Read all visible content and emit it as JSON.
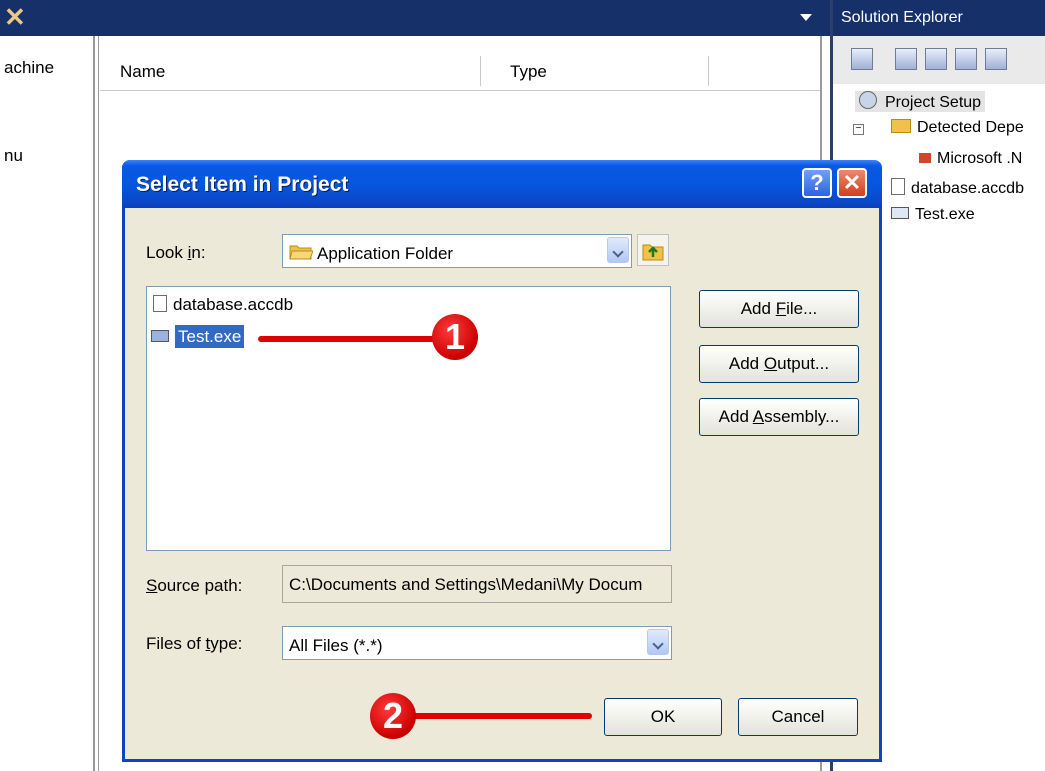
{
  "ide": {
    "left_pane": {
      "item_machine": "achine",
      "item_menu": "nu"
    },
    "list_columns": {
      "name": "Name",
      "type": "Type"
    }
  },
  "solution_explorer": {
    "title": "Solution Explorer",
    "tree": {
      "root": "Project Setup",
      "detected": "Detected Depe",
      "microsoft": "Microsoft .N",
      "database": "database.accdb",
      "test": "Test.exe"
    }
  },
  "dialog": {
    "title": "Select Item in Project",
    "help_label": "?",
    "close_label": "✕",
    "look_in_label_pre": "Look ",
    "look_in_label_u": "i",
    "look_in_label_post": "n:",
    "look_in_value": "Application Folder",
    "files": [
      "database.accdb",
      "Test.exe"
    ],
    "selected_file": "Test.exe",
    "add_file": {
      "pre": "Add ",
      "u": "F",
      "post": "ile..."
    },
    "add_output": {
      "pre": "Add ",
      "u": "O",
      "post": "utput..."
    },
    "add_assembly": {
      "pre": "Add ",
      "u": "A",
      "post": "ssembly..."
    },
    "source_path_label": {
      "u": "S",
      "post": "ource path:"
    },
    "source_path_value": "C:\\Documents and Settings\\Medani\\My Docum",
    "files_of_type_label": {
      "pre": "Files of ",
      "u": "t",
      "post": "ype:"
    },
    "files_of_type_value": "All Files (*.*)",
    "ok_label": "OK",
    "cancel_label": "Cancel"
  },
  "annotations": {
    "step1": "1",
    "step2": "2"
  },
  "colors": {
    "dialog_border": "#0a45c8",
    "selection": "#316ac5",
    "annotation_red": "#e00000"
  }
}
